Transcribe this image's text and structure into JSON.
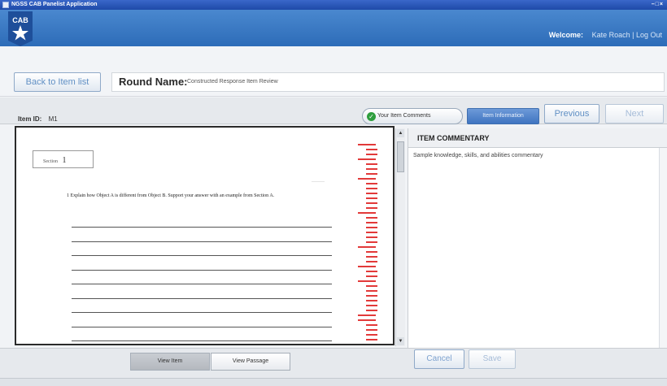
{
  "window": {
    "title": "NGSS CAB Panelist Application",
    "controls": "–□×"
  },
  "header": {
    "logo_text": "CAB",
    "welcome_label": "Welcome:",
    "user_name": "Kate Roach",
    "separator": "|",
    "logout_label": "Log Out"
  },
  "namebar": {
    "back_label": "Back to Item list",
    "round_label": "Round Name:",
    "round_value": "Constructed Response Item Review"
  },
  "itembar": {
    "item_id_label": "Item ID:",
    "item_id_value": "M1",
    "comments_label": "Your Item Comments",
    "info_label": "Item Information",
    "previous_label": "Previous",
    "next_label": "Next"
  },
  "item_view": {
    "section_label": "Section",
    "section_number": "1",
    "question_text": "1 Explain how Object A is different from Object B. Support your answer with an example from Section A.",
    "answer_lines": 10,
    "view_item_label": "View Item",
    "view_passage_label": "View Passage"
  },
  "commentary": {
    "heading": "ITEM COMMENTARY",
    "text": "Sample knowledge, skills, and abilities commentary",
    "cancel_label": "Cancel",
    "save_label": "Save"
  },
  "colors": {
    "header_blue": "#2d6cb8",
    "accent_blue": "#3f74c1",
    "mark_red": "#e23a3a",
    "check_green": "#2e9e3e"
  }
}
